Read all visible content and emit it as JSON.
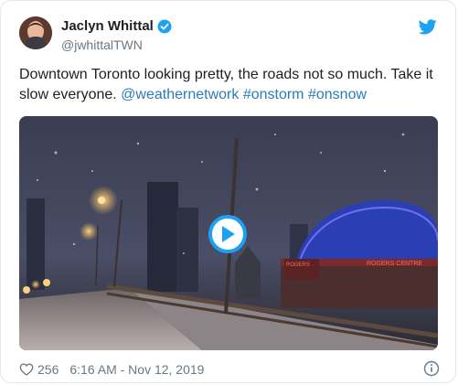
{
  "tweet": {
    "author_name": "Jaclyn Whittal",
    "author_handle": "@jwhittalTWN",
    "text_plain": "Downtown Toronto looking pretty, the roads not so much. Take it slow everyone. ",
    "mentions": [
      "@weathernetwork",
      "#onstorm",
      "#onsnow"
    ],
    "likes": "256",
    "timestamp": "6:16 AM - Nov 12, 2019"
  },
  "media": {
    "sign_left": "ROGERS",
    "sign_right": "ROGERS CENTRE"
  },
  "icons": {
    "verified": "verified-badge-icon",
    "brand": "twitter-bird-icon",
    "play": "play-icon",
    "like": "heart-icon",
    "info": "info-icon"
  },
  "colors": {
    "link": "#2b7bb9",
    "verified": "#1da1f2",
    "muted": "#697882"
  }
}
